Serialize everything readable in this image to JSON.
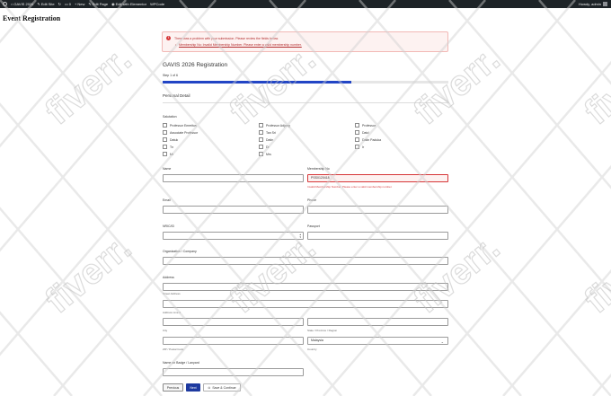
{
  "admin_bar": {
    "site_name": "GAVIS 2026",
    "edit_site": "Edit Site",
    "comments": "0",
    "new": "New",
    "edit_page": "Edit Page",
    "elementor": "Edit with Elementor",
    "wpcode": "WPCode",
    "howdy": "Howdy, admin"
  },
  "page": {
    "title": "Event Registration"
  },
  "error_notice": {
    "title": "There was a problem with your submission. Please review the fields below.",
    "item": "Membership No: Invalid Membership Number. Please enter a valid membership number."
  },
  "form": {
    "title": "GAVIS 2026 Registration",
    "step": "Step 1 of 6",
    "progress": 0.66,
    "section": "Personal Detail",
    "salutation_label": "Salutation",
    "salutations": [
      [
        "Professor Emeritus",
        "Professor Adjung",
        "Professor"
      ],
      [
        "Associate Professor",
        "Tan Sri",
        "Dato'"
      ],
      [
        "Datuk",
        "Datin",
        "Datin Paduka"
      ],
      [
        "Tn",
        "Dr",
        "Ir"
      ],
      [
        "Mr",
        "Mrs",
        ""
      ]
    ],
    "name_label": "Name",
    "membership_label": "Membership No",
    "membership_value": "PSS0120418",
    "membership_error": "Invalid Membership Number. Please enter a valid membership number.",
    "email_label": "Email",
    "phone_label": "Phone",
    "nric_label": "NRIC/ID",
    "passport_label": "Passport",
    "org_label": "Organization / Company",
    "address_label": "Address",
    "street_label": "Street Address",
    "line2_label": "Address Line 2",
    "city_label": "City",
    "state_label": "State / Province / Region",
    "postal_label": "ZIP / Postal Code",
    "country_label": "Country",
    "country_value": "Malaysia",
    "badge_label": "Name on Badge / Lanyard",
    "buttons": {
      "previous": "Previous",
      "next": "Next",
      "save": "Save & Continue"
    }
  },
  "watermark": {
    "text": "fiverr."
  }
}
